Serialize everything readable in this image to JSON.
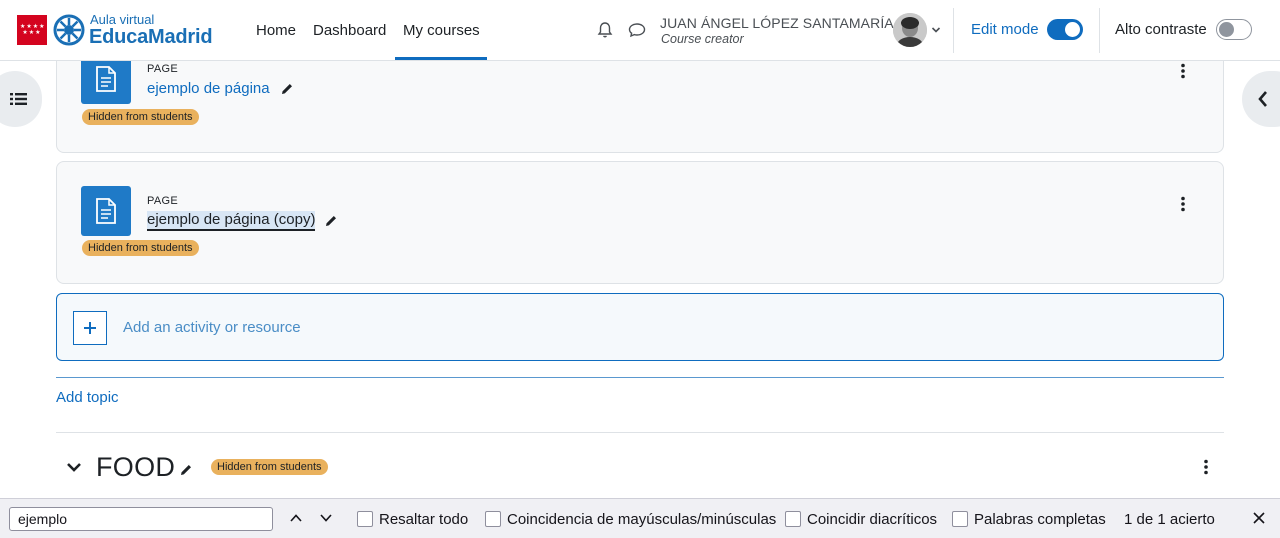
{
  "brand": {
    "sub": "Aula virtual",
    "main": "EducaMadrid"
  },
  "nav": {
    "links": [
      "Home",
      "Dashboard",
      "My courses"
    ],
    "active": "My courses"
  },
  "user": {
    "name": "JUAN ÁNGEL LÓPEZ SANTAMARÍA",
    "role": "Course creator"
  },
  "edit_mode": {
    "label": "Edit mode",
    "on": true
  },
  "high_contrast": {
    "label": "Alto contraste",
    "on": false
  },
  "activities": [
    {
      "type": "PAGE",
      "name": "ejemplo de página",
      "badge": "Hidden from students"
    },
    {
      "type": "PAGE",
      "name": "ejemplo de página (copy)",
      "badge": "Hidden from students"
    }
  ],
  "add_activity_label": "Add an activity or resource",
  "add_topic_label": "Add topic",
  "section": {
    "title": "FOOD",
    "badge": "Hidden from students"
  },
  "findbar": {
    "query": "ejemplo",
    "options": [
      "Resaltar todo",
      "Coincidencia de mayúsculas/minúsculas",
      "Coincidir diacríticos",
      "Palabras completas"
    ],
    "result": "1 de 1 acierto"
  },
  "colors": {
    "primary": "#0f6cbf",
    "badge": "#e9b15d",
    "brand_red": "#d4041f"
  }
}
